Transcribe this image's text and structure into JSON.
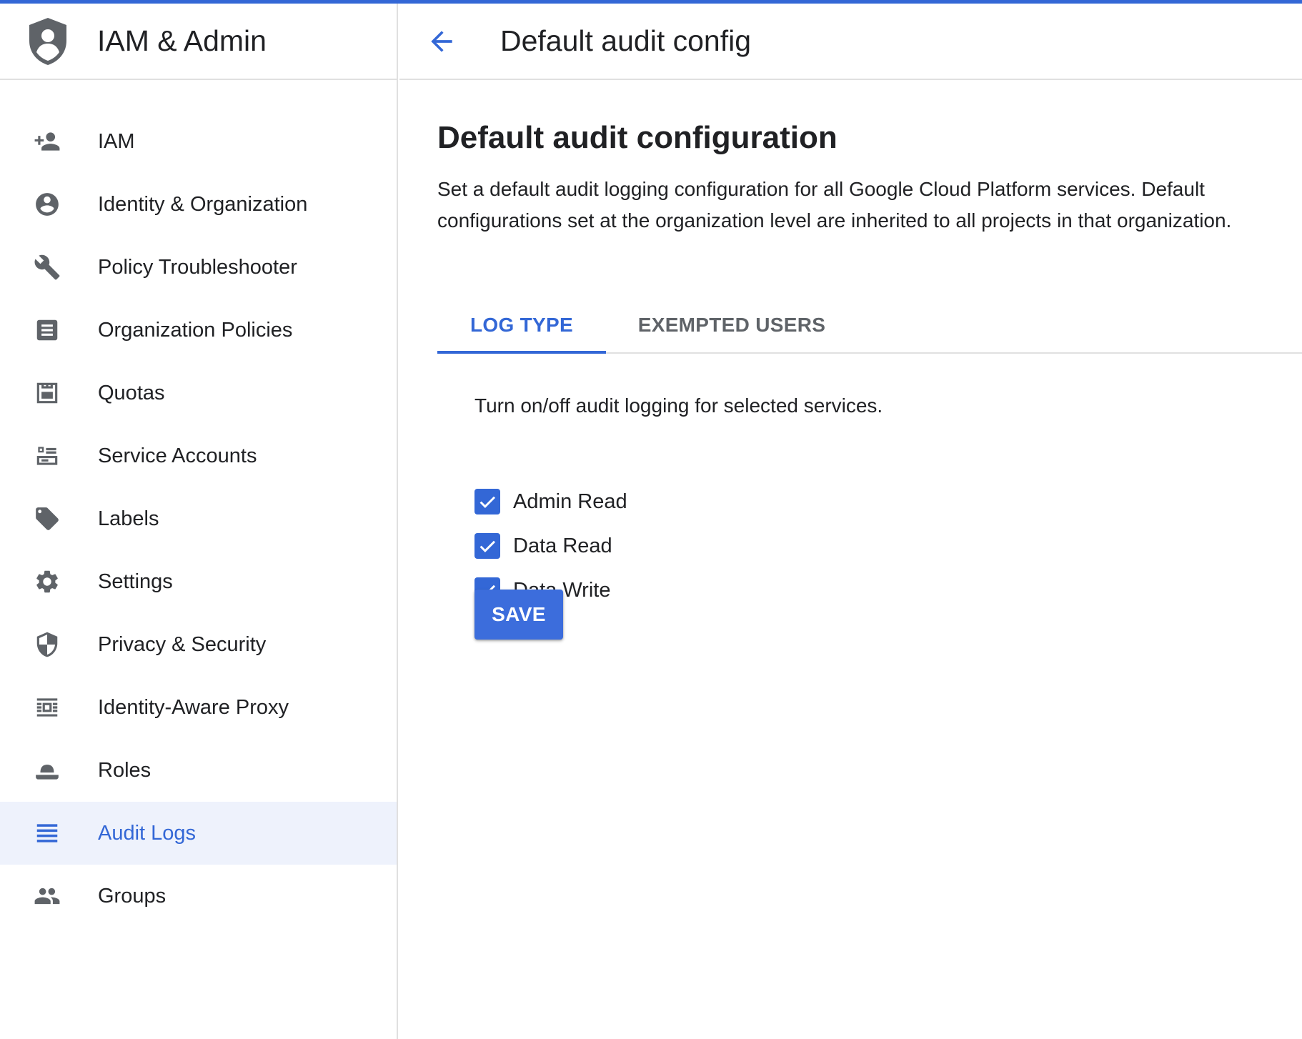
{
  "colors": {
    "accent": "#3367d6",
    "active_nav_bg": "#eef2fc",
    "icon_gray": "#5f6368"
  },
  "sidebar": {
    "product_logo_icon": "shield-person-icon",
    "title": "IAM & Admin",
    "items": [
      {
        "label": "IAM",
        "icon": "person-add-icon",
        "active": false
      },
      {
        "label": "Identity & Organization",
        "icon": "account-circle-icon",
        "active": false
      },
      {
        "label": "Policy Troubleshooter",
        "icon": "wrench-icon",
        "active": false
      },
      {
        "label": "Organization Policies",
        "icon": "document-list-icon",
        "active": false
      },
      {
        "label": "Quotas",
        "icon": "quota-icon",
        "active": false
      },
      {
        "label": "Service Accounts",
        "icon": "service-account-icon",
        "active": false
      },
      {
        "label": "Labels",
        "icon": "tag-icon",
        "active": false
      },
      {
        "label": "Settings",
        "icon": "gear-icon",
        "active": false
      },
      {
        "label": "Privacy & Security",
        "icon": "shield-icon",
        "active": false
      },
      {
        "label": "Identity-Aware Proxy",
        "icon": "proxy-icon",
        "active": false
      },
      {
        "label": "Roles",
        "icon": "hat-icon",
        "active": false
      },
      {
        "label": "Audit Logs",
        "icon": "list-lines-icon",
        "active": true
      },
      {
        "label": "Groups",
        "icon": "group-icon",
        "active": false
      }
    ]
  },
  "header": {
    "back_icon": "arrow-back-icon",
    "title": "Default audit config"
  },
  "main": {
    "section_title": "Default audit configuration",
    "description": "Set a default audit logging configuration for all Google Cloud Platform services. Default configurations set at the organization level are inherited to all projects in that organization.",
    "tabs": [
      {
        "label": "LOG TYPE",
        "active": true
      },
      {
        "label": "EXEMPTED USERS",
        "active": false
      }
    ],
    "hint": "Turn on/off audit logging for selected services.",
    "checkboxes": [
      {
        "label": "Admin Read",
        "checked": true
      },
      {
        "label": "Data Read",
        "checked": true
      },
      {
        "label": "Data Write",
        "checked": true
      }
    ],
    "save_label": "SAVE"
  }
}
